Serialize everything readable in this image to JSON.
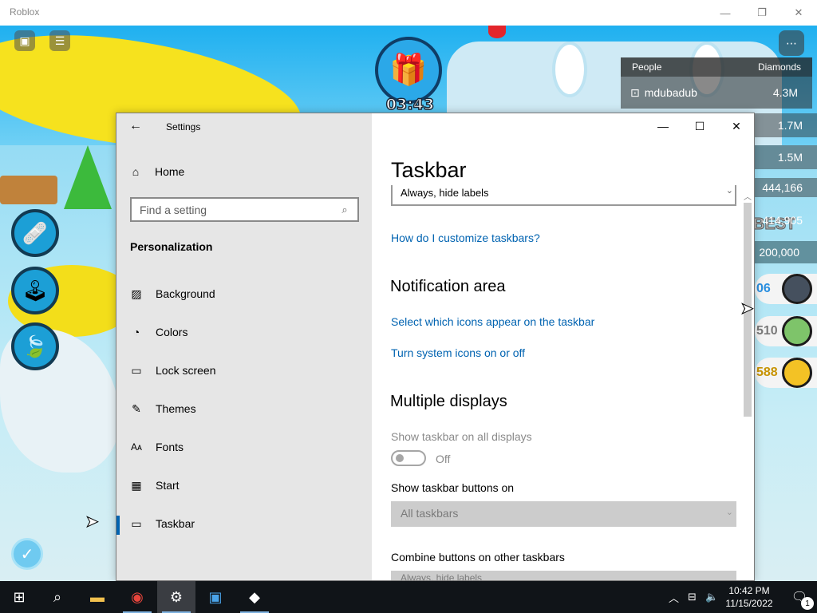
{
  "roblox": {
    "title": "Roblox",
    "controls": {
      "minimize": "—",
      "restore": "❐",
      "close": "✕"
    },
    "timer": "03:43",
    "leaderboard": {
      "header_people": "People",
      "header_diamonds": "Diamonds",
      "rows": [
        {
          "name": "mdubadub",
          "value": "4.3M"
        },
        {
          "name": "",
          "value": "1.7M"
        },
        {
          "name": "",
          "value": "1.5M"
        }
      ],
      "extra_values": [
        "444,166",
        "414,905",
        "200,000"
      ],
      "best_label": "BEST",
      "pills": [
        "06",
        "510",
        "588"
      ]
    }
  },
  "settings": {
    "window_title": "Settings",
    "nav": {
      "home_label": "Home",
      "search_placeholder": "Find a setting",
      "section_title": "Personalization",
      "items": [
        {
          "label": "Background",
          "icon": "image-icon"
        },
        {
          "label": "Colors",
          "icon": "palette-icon"
        },
        {
          "label": "Lock screen",
          "icon": "lock-screen-icon"
        },
        {
          "label": "Themes",
          "icon": "themes-icon"
        },
        {
          "label": "Fonts",
          "icon": "fonts-icon"
        },
        {
          "label": "Start",
          "icon": "start-icon"
        },
        {
          "label": "Taskbar",
          "icon": "taskbar-icon",
          "active": true
        }
      ]
    },
    "content": {
      "page_title": "Taskbar",
      "combine_value": "Always, hide labels",
      "customize_link": "How do I customize taskbars?",
      "notification_heading": "Notification area",
      "select_icons_link": "Select which icons appear on the taskbar",
      "system_icons_link": "Turn system icons on or off",
      "multiple_heading": "Multiple displays",
      "show_all_label": "Show taskbar on all displays",
      "toggle_state": "Off",
      "show_buttons_label": "Show taskbar buttons on",
      "show_buttons_value": "All taskbars",
      "combine_other_label": "Combine buttons on other taskbars",
      "combine_other_value": "Always, hide labels"
    }
  },
  "taskbar": {
    "clock_time": "10:42 PM",
    "clock_date": "11/15/2022",
    "notification_count": "1",
    "colors": {
      "background": "#101418",
      "accent": "#0063b1"
    }
  }
}
